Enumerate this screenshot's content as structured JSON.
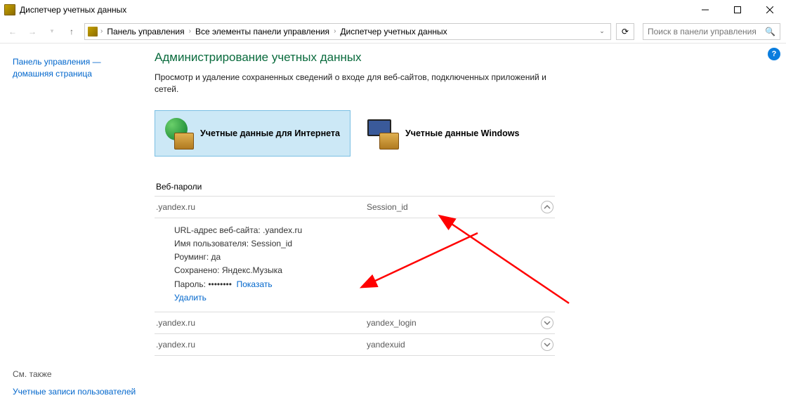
{
  "window": {
    "title": "Диспетчер учетных данных"
  },
  "breadcrumbs": [
    "Панель управления",
    "Все элементы панели управления",
    "Диспетчер учетных данных"
  ],
  "search": {
    "placeholder": "Поиск в панели управления"
  },
  "sidebar": {
    "homeLink": "Панель управления — домашняя страница",
    "footerHeader": "См. также",
    "footerLink": "Учетные записи пользователей"
  },
  "page": {
    "title": "Администрирование учетных данных",
    "description": "Просмотр и удаление сохраненных сведений о входе для веб-сайтов, подключенных приложений и сетей."
  },
  "tiles": {
    "web": "Учетные данные для Интернета",
    "windows": "Учетные данные Windows"
  },
  "section": {
    "header": "Веб-пароли"
  },
  "entries": [
    {
      "site": ".yandex.ru",
      "user": "Session_id",
      "expanded": true,
      "details": {
        "urlLabel": "URL-адрес веб-сайта:",
        "url": ".yandex.ru",
        "usernameLabel": "Имя пользователя:",
        "username": "Session_id",
        "roamingLabel": "Роуминг:",
        "roaming": "да",
        "savedLabel": "Сохранено:",
        "saved": "Яндекс.Музыка",
        "passwordLabel": "Пароль:",
        "passwordMask": "••••••••",
        "showLink": "Показать",
        "deleteLink": "Удалить"
      }
    },
    {
      "site": ".yandex.ru",
      "user": "yandex_login",
      "expanded": false
    },
    {
      "site": ".yandex.ru",
      "user": "yandexuid",
      "expanded": false
    }
  ]
}
